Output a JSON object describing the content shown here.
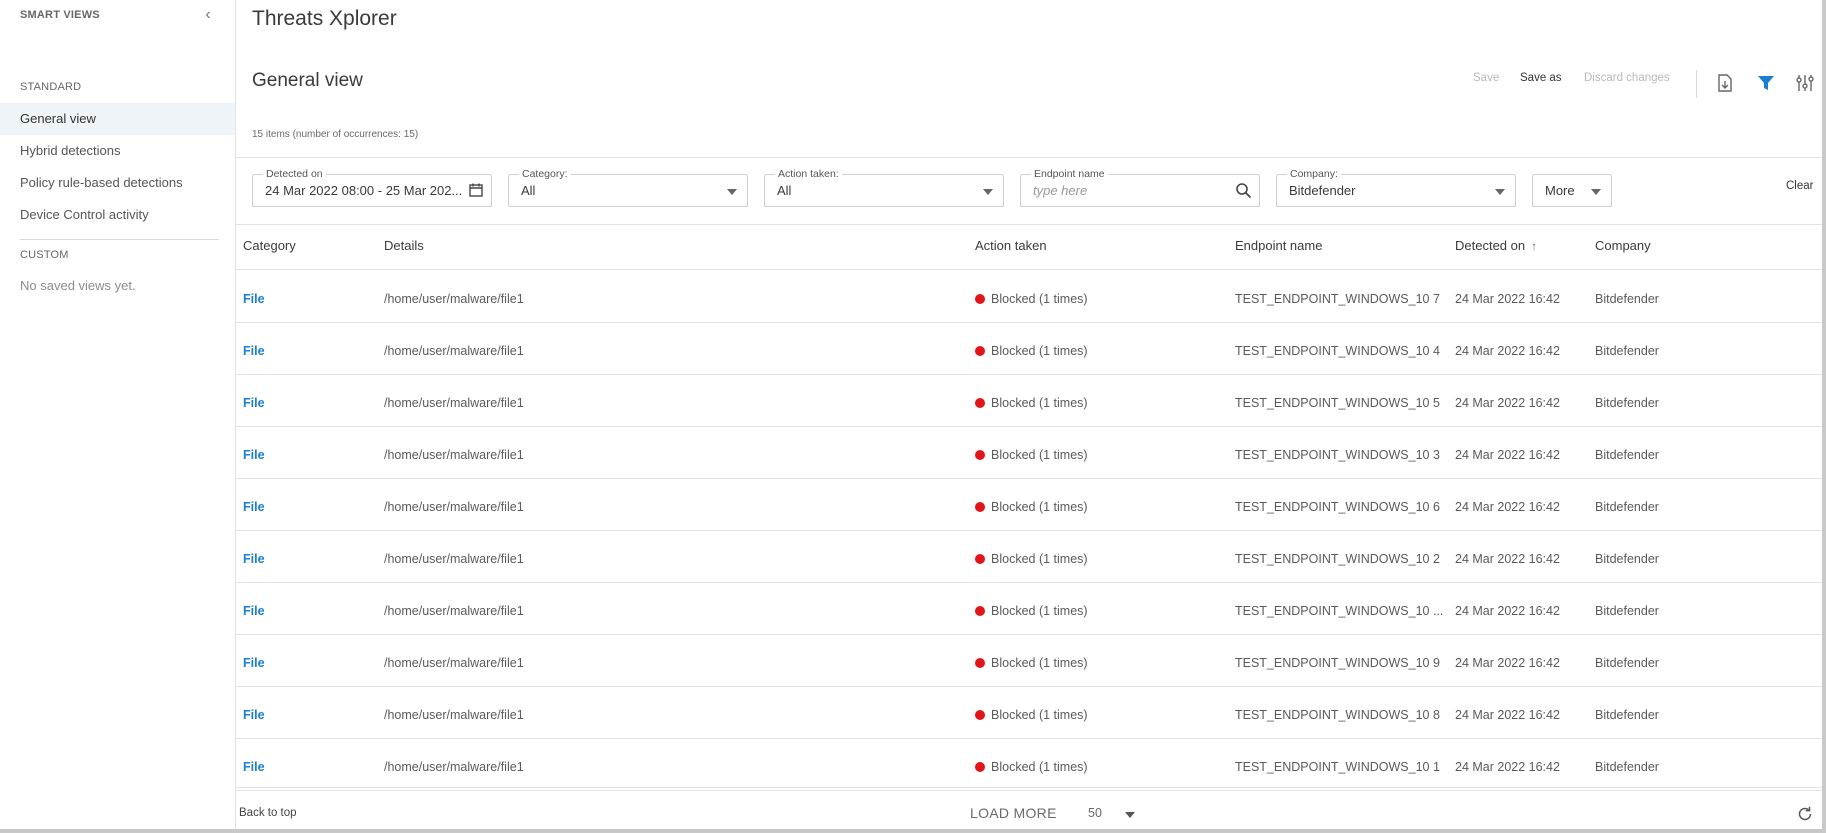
{
  "sidebar": {
    "title": "SMART VIEWS",
    "collapse_icon": "chevron-left-icon",
    "standard_label": "STANDARD",
    "standard_items": [
      {
        "label": "General view",
        "active": true
      },
      {
        "label": "Hybrid detections",
        "active": false
      },
      {
        "label": "Policy rule-based detections",
        "active": false
      },
      {
        "label": "Device Control activity",
        "active": false
      }
    ],
    "custom_label": "CUSTOM",
    "custom_empty": "No saved views yet."
  },
  "header": {
    "app_title": "Threats Xplorer",
    "view_title": "General view",
    "save_label": "Save",
    "save_as_label": "Save as",
    "discard_label": "Discard changes",
    "icons": [
      "export-icon",
      "filter-icon",
      "column-settings-icon"
    ],
    "accent_color": "#1a7fd2",
    "item_count": "15 items (number of occurrences: 15)"
  },
  "filters": {
    "detected_on": {
      "label": "Detected on",
      "value": "24 Mar 2022 08:00 - 25 Mar 202..."
    },
    "category": {
      "label": "Category:",
      "value": "All"
    },
    "action_taken": {
      "label": "Action taken:",
      "value": "All"
    },
    "endpoint_name": {
      "label": "Endpoint name",
      "placeholder": "type here"
    },
    "company": {
      "label": "Company:",
      "value": "Bitdefender"
    },
    "more_label": "More",
    "clear_label": "Clear"
  },
  "table": {
    "columns": [
      "Category",
      "Details",
      "Action taken",
      "Endpoint name",
      "Detected on",
      "Company"
    ],
    "sort_indicator": "↑",
    "status_color": "#e0161b",
    "rows": [
      {
        "category": "File",
        "details": "/home/user/malware/file1",
        "action": "Blocked (1 times)",
        "endpoint": "TEST_ENDPOINT_WINDOWS_10 7",
        "detected": "24 Mar 2022 16:42",
        "company": "Bitdefender"
      },
      {
        "category": "File",
        "details": "/home/user/malware/file1",
        "action": "Blocked (1 times)",
        "endpoint": "TEST_ENDPOINT_WINDOWS_10 4",
        "detected": "24 Mar 2022 16:42",
        "company": "Bitdefender"
      },
      {
        "category": "File",
        "details": "/home/user/malware/file1",
        "action": "Blocked (1 times)",
        "endpoint": "TEST_ENDPOINT_WINDOWS_10 5",
        "detected": "24 Mar 2022 16:42",
        "company": "Bitdefender"
      },
      {
        "category": "File",
        "details": "/home/user/malware/file1",
        "action": "Blocked (1 times)",
        "endpoint": "TEST_ENDPOINT_WINDOWS_10 3",
        "detected": "24 Mar 2022 16:42",
        "company": "Bitdefender"
      },
      {
        "category": "File",
        "details": "/home/user/malware/file1",
        "action": "Blocked (1 times)",
        "endpoint": "TEST_ENDPOINT_WINDOWS_10 6",
        "detected": "24 Mar 2022 16:42",
        "company": "Bitdefender"
      },
      {
        "category": "File",
        "details": "/home/user/malware/file1",
        "action": "Blocked (1 times)",
        "endpoint": "TEST_ENDPOINT_WINDOWS_10 2",
        "detected": "24 Mar 2022 16:42",
        "company": "Bitdefender"
      },
      {
        "category": "File",
        "details": "/home/user/malware/file1",
        "action": "Blocked (1 times)",
        "endpoint": "TEST_ENDPOINT_WINDOWS_10 ...",
        "detected": "24 Mar 2022 16:42",
        "company": "Bitdefender"
      },
      {
        "category": "File",
        "details": "/home/user/malware/file1",
        "action": "Blocked (1 times)",
        "endpoint": "TEST_ENDPOINT_WINDOWS_10 9",
        "detected": "24 Mar 2022 16:42",
        "company": "Bitdefender"
      },
      {
        "category": "File",
        "details": "/home/user/malware/file1",
        "action": "Blocked (1 times)",
        "endpoint": "TEST_ENDPOINT_WINDOWS_10 8",
        "detected": "24 Mar 2022 16:42",
        "company": "Bitdefender"
      },
      {
        "category": "File",
        "details": "/home/user/malware/file1",
        "action": "Blocked (1 times)",
        "endpoint": "TEST_ENDPOINT_WINDOWS_10 1",
        "detected": "24 Mar 2022 16:42",
        "company": "Bitdefender"
      }
    ]
  },
  "footer": {
    "back_to_top": "Back to top",
    "load_more": "LOAD MORE",
    "page_size": "50",
    "refresh_icon": "refresh-icon"
  }
}
